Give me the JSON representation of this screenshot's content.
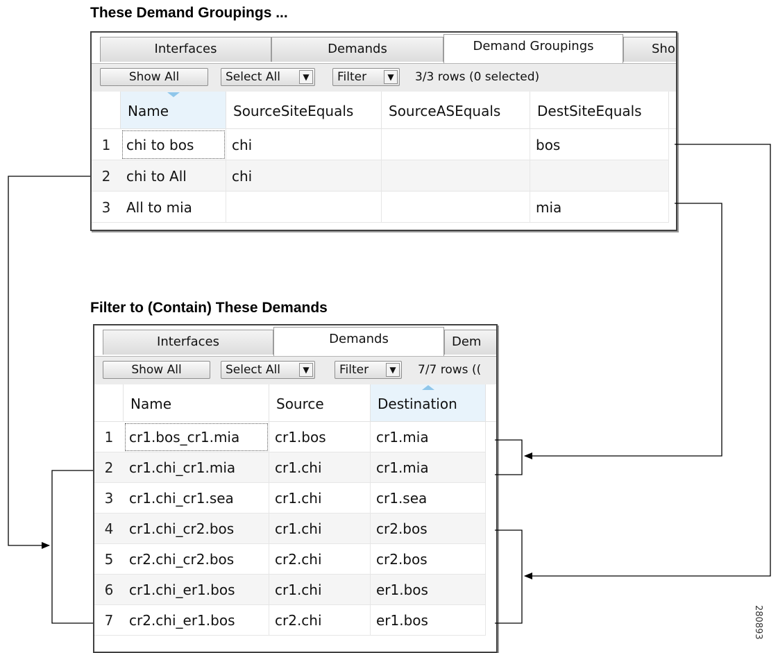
{
  "top": {
    "heading": "These Demand Groupings ...",
    "tabs": [
      "Interfaces",
      "Demands",
      "Demand Groupings",
      "Sho"
    ],
    "toolbar": {
      "show_all": "Show All",
      "select_all": "Select All",
      "filter": "Filter",
      "row_count": "3/3 rows (0 selected)"
    },
    "columns": [
      "Name",
      "SourceSiteEquals",
      "SourceASEquals",
      "DestSiteEquals"
    ],
    "rows": [
      {
        "num": "1",
        "cells": [
          "chi to bos",
          "chi",
          "",
          "bos"
        ]
      },
      {
        "num": "2",
        "cells": [
          "chi to All",
          "chi",
          "",
          ""
        ]
      },
      {
        "num": "3",
        "cells": [
          "All to mia",
          "",
          "",
          "mia"
        ]
      }
    ]
  },
  "bottom": {
    "heading": "Filter to (Contain) These Demands",
    "tabs": [
      "Interfaces",
      "Demands",
      "Dem"
    ],
    "toolbar": {
      "show_all": "Show All",
      "select_all": "Select All",
      "filter": "Filter",
      "row_count": "7/7 rows (("
    },
    "columns": [
      "Name",
      "Source",
      "Destination"
    ],
    "rows": [
      {
        "num": "1",
        "cells": [
          "cr1.bos_cr1.mia",
          "cr1.bos",
          "cr1.mia"
        ]
      },
      {
        "num": "2",
        "cells": [
          "cr1.chi_cr1.mia",
          "cr1.chi",
          "cr1.mia"
        ]
      },
      {
        "num": "3",
        "cells": [
          "cr1.chi_cr1.sea",
          "cr1.chi",
          "cr1.sea"
        ]
      },
      {
        "num": "4",
        "cells": [
          "cr1.chi_cr2.bos",
          "cr1.chi",
          "cr2.bos"
        ]
      },
      {
        "num": "5",
        "cells": [
          "cr2.chi_cr2.bos",
          "cr2.chi",
          "cr2.bos"
        ]
      },
      {
        "num": "6",
        "cells": [
          "cr1.chi_er1.bos",
          "cr1.chi",
          "er1.bos"
        ]
      },
      {
        "num": "7",
        "cells": [
          "cr2.chi_er1.bos",
          "cr2.chi",
          "er1.bos"
        ]
      }
    ]
  },
  "figure_id": "280893",
  "icons": {
    "dropdown": "caret-down-icon",
    "sort_indicator": "sort-caret-icon",
    "arrow": "arrowhead-icon"
  },
  "colors": {
    "sorted_header": "#e8f3fb",
    "sort_caret": "#8fc6ea",
    "connector": "#000000"
  }
}
